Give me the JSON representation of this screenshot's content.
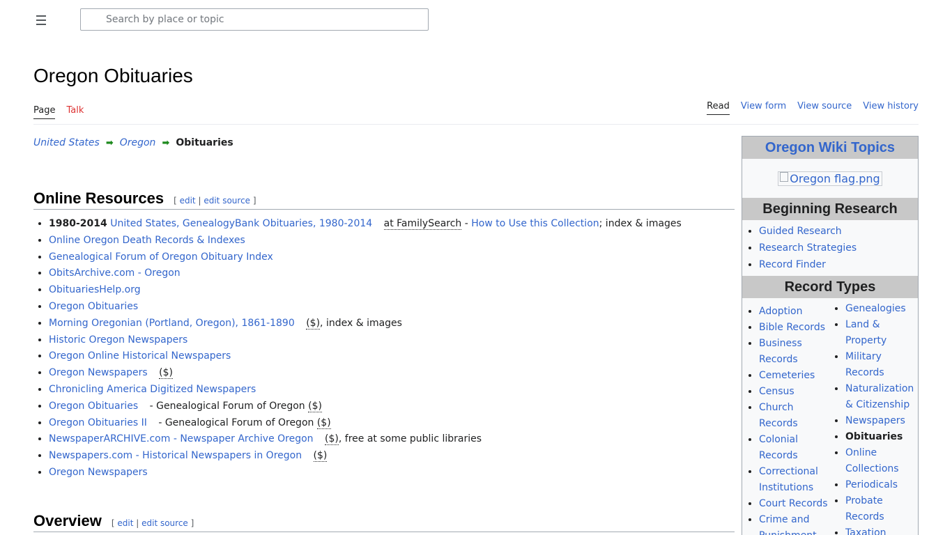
{
  "header": {
    "search_placeholder": "Search by place or topic"
  },
  "page": {
    "title": "Oregon Obituaries"
  },
  "tabs_left": [
    {
      "label": "Page"
    },
    {
      "label": "Talk"
    }
  ],
  "tabs_right": [
    {
      "label": "Read"
    },
    {
      "label": "View form"
    },
    {
      "label": "View source"
    },
    {
      "label": "View history"
    }
  ],
  "breadcrumb": {
    "items": [
      "United States",
      "Oregon"
    ],
    "arrow": "➡",
    "current": "Obituaries"
  },
  "sections": {
    "online_resources": {
      "title": "Online Resources",
      "edit": "edit",
      "edit_source": "edit source",
      "bracket_open": "[",
      "sep": "|",
      "bracket_close": "]"
    },
    "overview": {
      "title": "Overview",
      "edit": "edit",
      "edit_source": "edit source",
      "bracket_open": "[",
      "sep": "|",
      "bracket_close": "]"
    }
  },
  "resources": [
    {
      "prefix": "1980-2014",
      "link": "United States, GenealogyBank Obituaries, 1980-2014",
      "at": "at FamilySearch",
      "dash": "-",
      "link2": "How to Use this Collection",
      "suffix": "; index & images"
    },
    {
      "link": "Online Oregon Death Records & Indexes"
    },
    {
      "link": "Genealogical Forum of Oregon Obituary Index"
    },
    {
      "link": "ObitsArchive.com - Oregon"
    },
    {
      "link": "ObituariesHelp.org"
    },
    {
      "link": "Oregon Obituaries"
    },
    {
      "link": "Morning Oregonian (Portland, Oregon), 1861-1890",
      "paid": "($)",
      "suffix": ", index & images"
    },
    {
      "link": "Historic Oregon Newspapers"
    },
    {
      "link": "Oregon Online Historical Newspapers"
    },
    {
      "link": "Oregon Newspapers",
      "paid": "($)"
    },
    {
      "link": "Chronicling America Digitized Newspapers"
    },
    {
      "link": "Oregon Obituaries",
      "note": "- Genealogical Forum of Oregon",
      "paid": "($)"
    },
    {
      "link": "Oregon Obituaries II",
      "note": "- Genealogical Forum of Oregon",
      "paid": "($)"
    },
    {
      "link": "NewspaperARCHIVE.com - Newspaper Archive Oregon",
      "paid": "($)",
      "suffix": ", free at some public libraries"
    },
    {
      "link": "Newspapers.com - Historical Newspapers in Oregon",
      "paid": "($)"
    },
    {
      "link": "Oregon Newspapers"
    }
  ],
  "sidebar": {
    "title": "Oregon Wiki Topics",
    "flag_alt": "Oregon flag.png",
    "beginning_title": "Beginning Research",
    "beginning_items": [
      "Guided Research",
      "Research Strategies",
      "Record Finder"
    ],
    "record_types_title": "Record Types",
    "col1": [
      "Adoption",
      "Bible Records",
      "Business Records",
      "Cemeteries",
      "Census",
      "Church Records",
      "Colonial Records",
      "Correctional Institutions",
      "Court Records",
      "Crime and Punishment"
    ],
    "col2": [
      "Genealogies",
      "Land & Property",
      "Military Records",
      "Naturalization & Citizenship",
      "Newspapers",
      "Obituaries",
      "Online Collections",
      "Periodicals",
      "Probate Records",
      "Taxation"
    ]
  },
  "colors": {
    "link": "#3366cc",
    "talk_red": "#d33",
    "arrow_green": "#1e8a1e",
    "sidebar_header": "#c8c8c8"
  }
}
